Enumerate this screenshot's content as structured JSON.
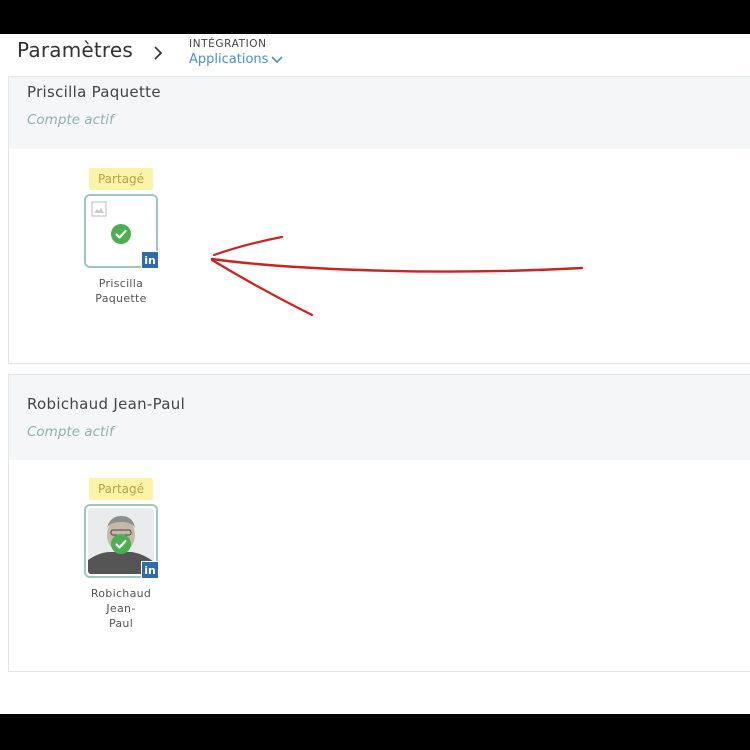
{
  "header": {
    "title": "Paramètres",
    "breadcrumb_top": "INTÉGRATION",
    "breadcrumb_link": "Applications"
  },
  "accounts": [
    {
      "name": "Priscilla Paquette",
      "status": "Compte actif",
      "badge": "Partagé",
      "tile_label_line1": "Priscilla",
      "tile_label_line2": "Paquette",
      "network_icon": "linkedin-icon",
      "avatar": "broken-image"
    },
    {
      "name": "Robichaud Jean-Paul",
      "status": "Compte actif",
      "badge": "Partagé",
      "tile_label_line1": "Robichaud Jean-",
      "tile_label_line2": "Paul",
      "network_icon": "linkedin-icon",
      "avatar": "profile-photo"
    }
  ],
  "icons": {
    "linkedin_text": "in"
  },
  "colors": {
    "accent": "#4a90c8",
    "status": "#8fb2ad",
    "badge_bg": "#fbf3a7",
    "check": "#4caf50",
    "linkedin": "#2d6cae",
    "annotation_arrow": "#cc2222"
  }
}
